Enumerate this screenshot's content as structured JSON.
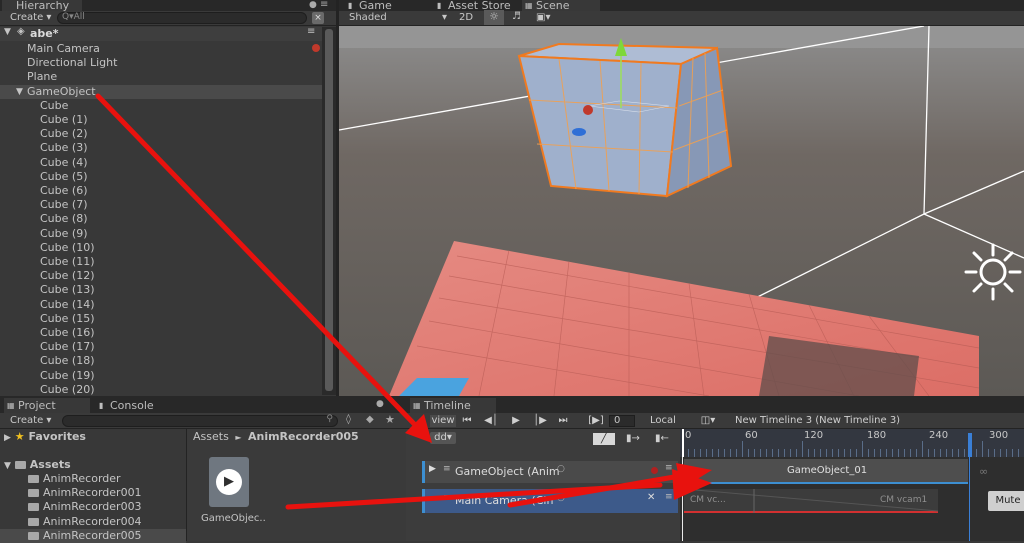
{
  "hierarchy": {
    "tab_label": "Hierarchy",
    "create_label": "Create ▾",
    "search_placeholder": "Q▾All",
    "scene_name": "abe*",
    "items": [
      {
        "label": "Main Camera"
      },
      {
        "label": "Directional Light"
      },
      {
        "label": "Plane"
      },
      {
        "label": "GameObject"
      },
      {
        "label": "Cube"
      },
      {
        "label": "Cube (1)"
      },
      {
        "label": "Cube (2)"
      },
      {
        "label": "Cube (3)"
      },
      {
        "label": "Cube (4)"
      },
      {
        "label": "Cube (5)"
      },
      {
        "label": "Cube (6)"
      },
      {
        "label": "Cube (7)"
      },
      {
        "label": "Cube (8)"
      },
      {
        "label": "Cube (9)"
      },
      {
        "label": "Cube (10)"
      },
      {
        "label": "Cube (11)"
      },
      {
        "label": "Cube (12)"
      },
      {
        "label": "Cube (13)"
      },
      {
        "label": "Cube (14)"
      },
      {
        "label": "Cube (15)"
      },
      {
        "label": "Cube (16)"
      },
      {
        "label": "Cube (17)"
      },
      {
        "label": "Cube (18)"
      },
      {
        "label": "Cube (19)"
      },
      {
        "label": "Cube (20)"
      }
    ]
  },
  "scene_tabs": {
    "game": "Game",
    "asset_store": "Asset Store",
    "scene": "Scene"
  },
  "scene_toolbar": {
    "shading": "Shaded",
    "mode_2d": "2D"
  },
  "project": {
    "tab_label": "Project",
    "console_label": "Console",
    "create_label": "Create ▾",
    "favorites": "Favorites",
    "assets": "Assets",
    "folders": [
      "AnimRecorder",
      "AnimRecorder001",
      "AnimRecorder003",
      "AnimRecorder004",
      "AnimRecorder005"
    ],
    "breadcrumb_root": "Assets",
    "breadcrumb_sep": "►",
    "breadcrumb_current": "AnimRecorder005",
    "asset_label": "GameObjec.."
  },
  "timeline": {
    "tab_label": "Timeline",
    "preview_label": "view",
    "frame_field": "0",
    "local_label": "Local",
    "timeline_title": "New Timeline 3 (New Timeline 3)",
    "add_label": "dd▾",
    "ruler_labels": [
      "0",
      "60",
      "120",
      "180",
      "240",
      "300"
    ],
    "tracks": [
      {
        "label": "GameObject (Anim"
      },
      {
        "label": "Main Camera (Cin"
      }
    ],
    "clip_gameobject": "GameObject_01",
    "clip_cm_left": "CM vc...",
    "clip_cm_right": "CM vcam1",
    "mute_label": "Mute"
  },
  "colors": {
    "panel": "#383838",
    "selected_track": "#3d5a8a",
    "cube_outline": "#f07a20",
    "plane": "#e87c72",
    "arrow": "#e8120e"
  }
}
